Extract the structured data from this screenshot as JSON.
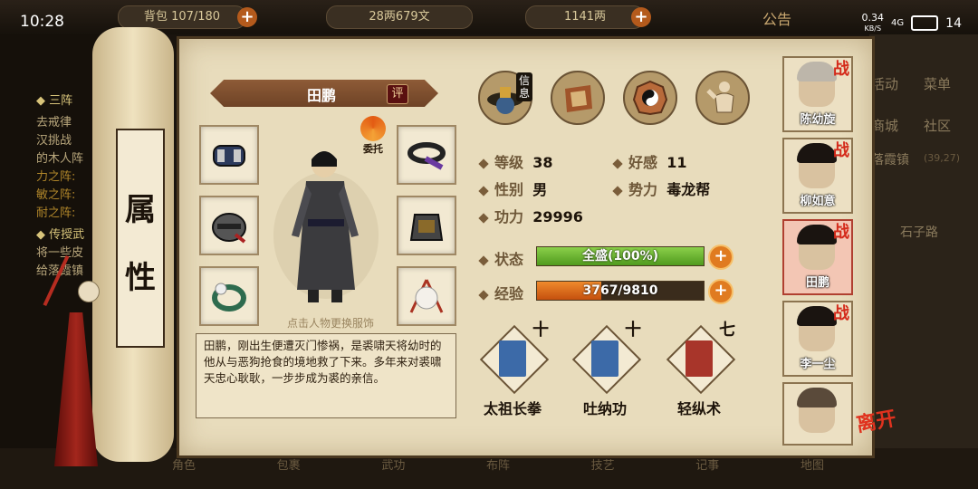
{
  "status": {
    "time": "10:28",
    "net_speed": "0.34",
    "net_unit": "KB/S",
    "signal": "4G",
    "battery": "14"
  },
  "hud": {
    "bag_text": "107/180",
    "bag_prefix": "背包",
    "money": "28两679文",
    "gold": "1141两",
    "announce": "公告"
  },
  "background": {
    "left_lines": [
      "◆ 三阵",
      "去戒律",
      "汉挑战",
      "的木人阵",
      "力之阵:",
      "敏之阵:",
      "耐之阵:",
      "◆ 传授武",
      "将一些皮",
      "给落霞镇"
    ],
    "right_items": [
      "活动",
      "菜单",
      "商城",
      "社区",
      "落霞镇",
      "(39,27)",
      "石子路"
    ],
    "bottom_items": [
      "角色",
      "包裹",
      "武功",
      "布阵",
      "技艺",
      "记事",
      "地图"
    ]
  },
  "scroll": {
    "title_char1": "属",
    "title_char2": "性"
  },
  "character": {
    "name": "田鹏",
    "eval": "评",
    "entrust": "委托",
    "hint": "点击人物更换服饰",
    "description": "田鹏，刚出生便遭灭门惨祸，是裘啸天将幼时的他从与恶狗抢食的境地救了下来。多年来对裘啸天忠心耿耿，一步步成为裘的亲信。"
  },
  "tabs": [
    {
      "label": "信息",
      "icon": "hat-icon"
    },
    {
      "label": "",
      "icon": "banner-icon"
    },
    {
      "label": "",
      "icon": "bagua-icon"
    },
    {
      "label": "",
      "icon": "muscle-icon"
    }
  ],
  "stats": {
    "level_label": "等级",
    "level": "38",
    "favor_label": "好感",
    "favor": "11",
    "gender_label": "性别",
    "gender": "男",
    "faction_label": "势力",
    "faction": "毒龙帮",
    "power_label": "功力",
    "power": "29996",
    "state_label": "状态",
    "state_text": "全盛(100%)",
    "state_fraction": 1.0,
    "exp_label": "经验",
    "exp_text": "3767/9810",
    "exp_fraction": 0.384,
    "plus": "+"
  },
  "skills": [
    {
      "name": "太祖长拳",
      "level": "十",
      "color": "#3c6aa8"
    },
    {
      "name": "吐纳功",
      "level": "十",
      "color": "#3c6aa8"
    },
    {
      "name": "轻纵术",
      "level": "七",
      "color": "#a8352a"
    }
  ],
  "roster": [
    {
      "name": "陈幼旋",
      "badge": "战"
    },
    {
      "name": "柳如意",
      "badge": "战"
    },
    {
      "name": "田鹏",
      "badge": "战"
    },
    {
      "name": "李一尘",
      "badge": "战"
    },
    {
      "name": "",
      "badge": ""
    }
  ],
  "leave": "离开",
  "colors": {
    "accent": "#e07b20",
    "hp_bar": "#6fb22f",
    "exp_bar": "#e1681c",
    "panel": "#e8dcbc"
  }
}
